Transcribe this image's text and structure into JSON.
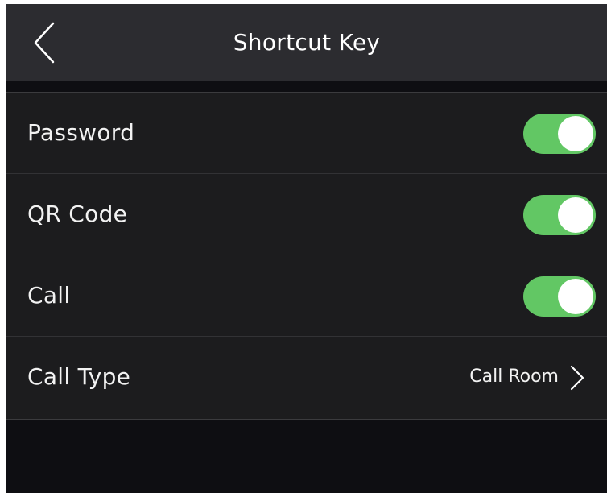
{
  "header": {
    "title": "Shortcut Key",
    "back_icon": "chevron-left-icon"
  },
  "rows": [
    {
      "label": "Password",
      "control": "toggle",
      "enabled": true
    },
    {
      "label": "QR Code",
      "control": "toggle",
      "enabled": true
    },
    {
      "label": "Call",
      "control": "toggle",
      "enabled": true
    },
    {
      "label": "Call Type",
      "control": "link",
      "value": "Call Room",
      "icon": "chevron-right-icon"
    }
  ],
  "colors": {
    "toggle_on": "#62c764",
    "header_bg": "#2c2c30",
    "list_bg": "#1c1c1e",
    "screen_bg": "#0e0e12"
  }
}
